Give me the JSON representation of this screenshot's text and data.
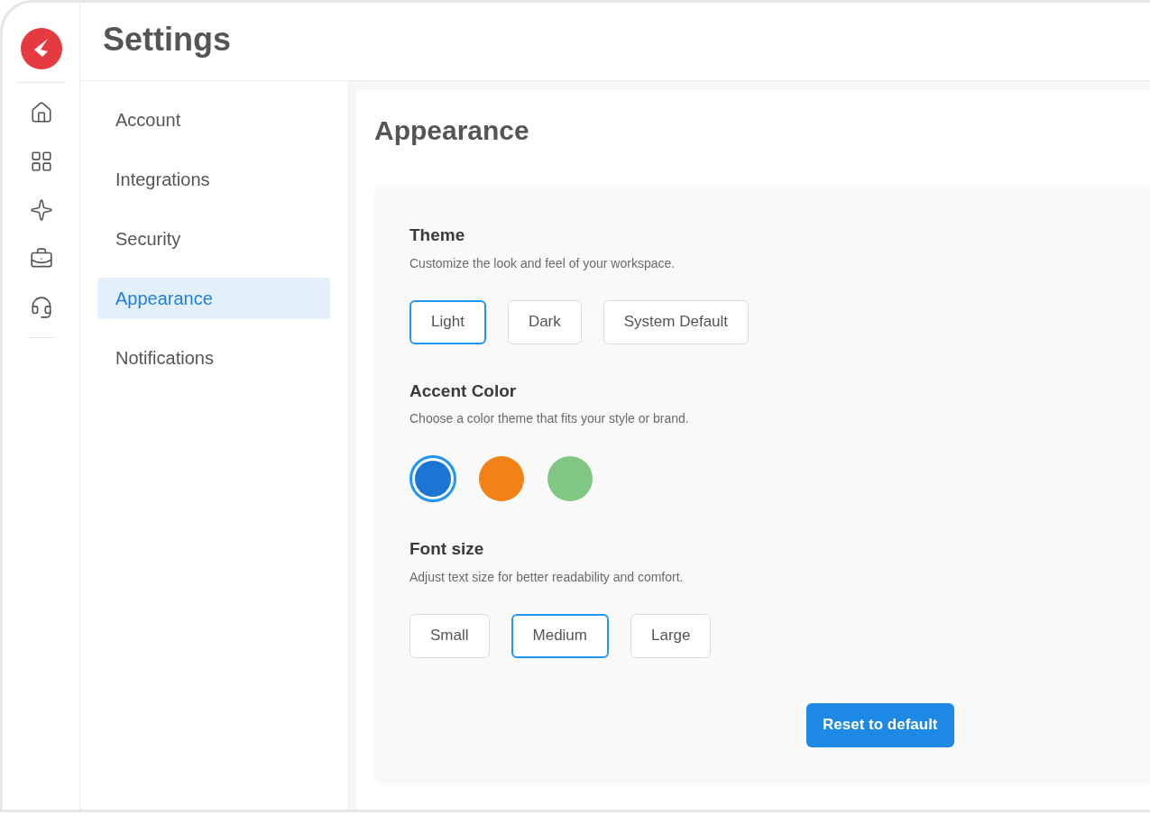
{
  "header": {
    "title": "Settings"
  },
  "rail": [
    {
      "kind": "home",
      "selected": false
    },
    {
      "kind": "grid",
      "selected": false
    },
    {
      "kind": "sparkle",
      "selected": false
    },
    {
      "kind": "briefcase",
      "selected": false
    },
    {
      "kind": "headset",
      "selected": false
    }
  ],
  "nav": [
    {
      "label": "Account",
      "selected": false
    },
    {
      "label": "Integrations",
      "selected": false
    },
    {
      "label": "Security",
      "selected": false
    },
    {
      "label": "Appearance",
      "selected": true
    },
    {
      "label": "Notifications",
      "selected": false
    }
  ],
  "panel": {
    "title": "Appearance",
    "sections": [
      {
        "kind": "buttons",
        "title": "Theme",
        "description": "Customize the look and feel of your workspace.",
        "options": [
          {
            "label": "Light",
            "selected": true
          },
          {
            "label": "Dark",
            "selected": false
          },
          {
            "label": "System Default",
            "selected": false
          }
        ]
      },
      {
        "kind": "swatches",
        "title": "Accent Color",
        "description": "Choose a color theme that fits your style or brand.",
        "options": [
          {
            "color": "#1a76d2",
            "selected": true
          },
          {
            "color": "#f28118",
            "selected": false
          },
          {
            "color": "#81c784",
            "selected": false
          }
        ]
      },
      {
        "kind": "buttons",
        "title": "Font size",
        "description": "Adjust text size for better readability and comfort.",
        "options": [
          {
            "label": "Small",
            "selected": false
          },
          {
            "label": "Medium",
            "selected": true
          },
          {
            "label": "Large",
            "selected": false
          }
        ]
      }
    ],
    "reset_button": "Reset to default"
  }
}
